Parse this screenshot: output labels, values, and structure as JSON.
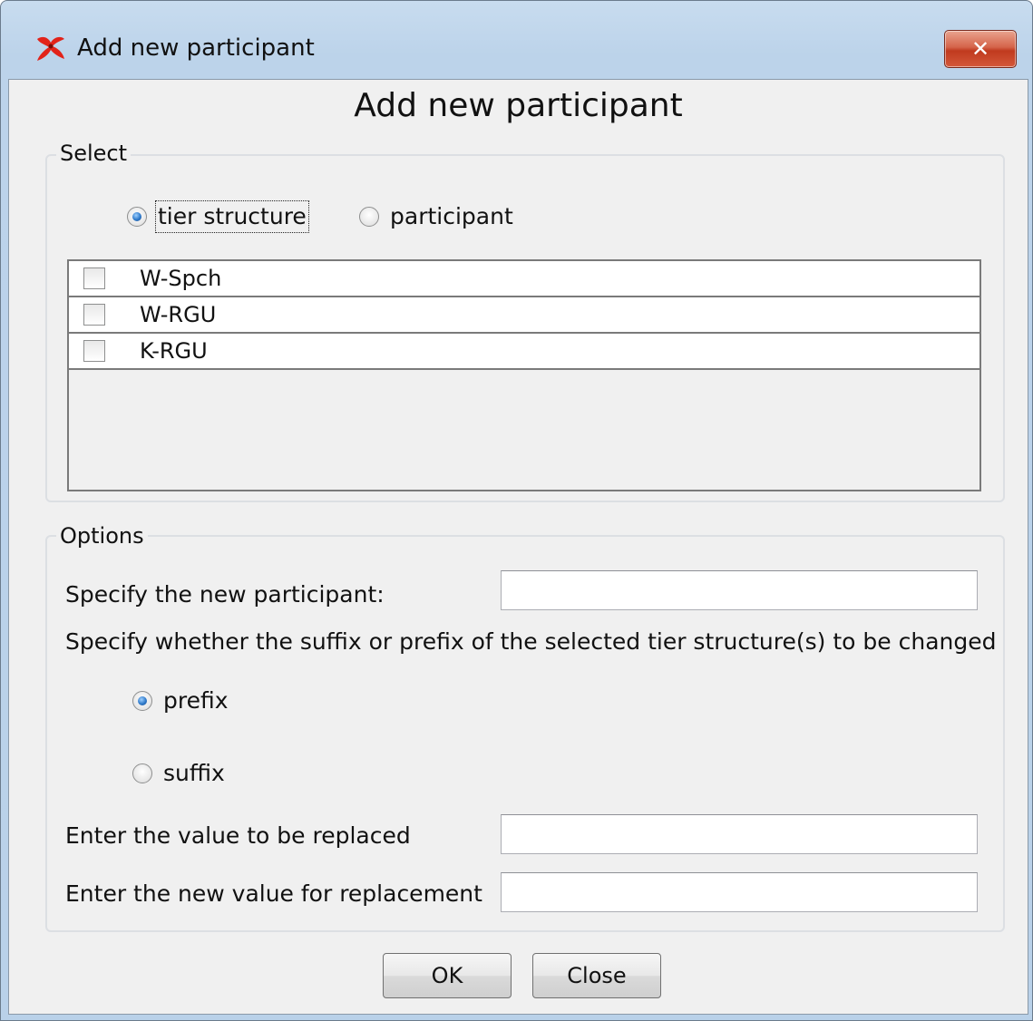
{
  "window": {
    "title": "Add new participant",
    "close_glyph": "✕"
  },
  "dialog": {
    "heading": "Add new participant"
  },
  "select_group": {
    "label": "Select",
    "radios": [
      {
        "label": "tier structure",
        "selected": true
      },
      {
        "label": "participant",
        "selected": false
      }
    ],
    "tiers": [
      {
        "label": "W-Spch",
        "checked": false
      },
      {
        "label": "W-RGU",
        "checked": false
      },
      {
        "label": "K-RGU",
        "checked": false
      }
    ]
  },
  "options_group": {
    "label": "Options",
    "participant_label": "Specify the new participant:",
    "participant_value": "",
    "affix_question": "Specify whether the suffix or prefix of the selected tier structure(s) to be changed",
    "affix_radios": [
      {
        "label": "prefix",
        "selected": true
      },
      {
        "label": "suffix",
        "selected": false
      }
    ],
    "replace_label": "Enter the value to be replaced",
    "replace_value": "",
    "replacement_label": "Enter the new value for replacement",
    "replacement_value": ""
  },
  "buttons": {
    "ok": "OK",
    "close": "Close"
  },
  "colors": {
    "accent_radio": "#2e79c9",
    "close_button": "#c03a1e",
    "title_bar": "#bcd3ea"
  },
  "icons": {
    "app": "elan-app-icon",
    "close": "close-icon"
  }
}
